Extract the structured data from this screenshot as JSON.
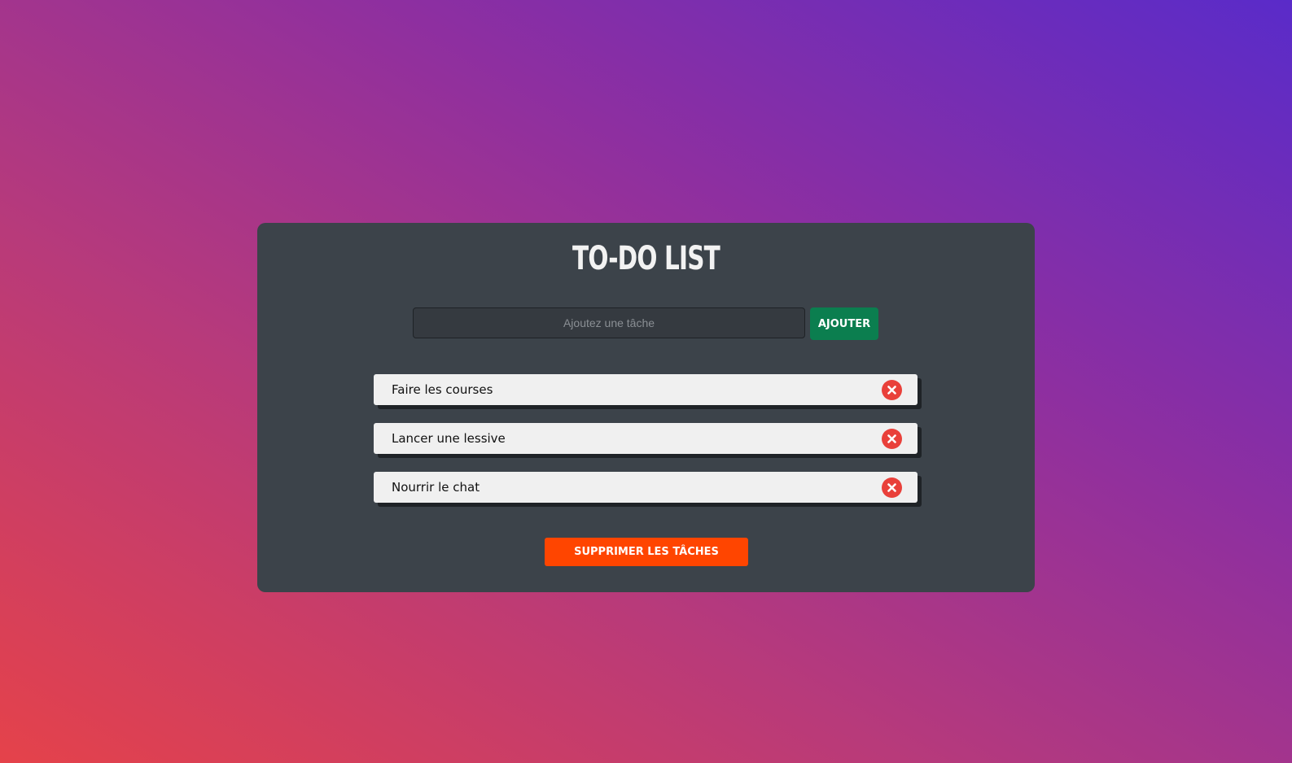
{
  "app": {
    "title": "TO-DO LIST"
  },
  "input": {
    "placeholder": "Ajoutez une tâche",
    "value": ""
  },
  "add_button": {
    "label": "AJOUTER"
  },
  "tasks": [
    {
      "label": "Faire les courses",
      "delete_icon": "close-icon"
    },
    {
      "label": "Lancer une lessive",
      "delete_icon": "close-icon"
    },
    {
      "label": "Nourrir le chat",
      "delete_icon": "close-icon"
    }
  ],
  "clear_button": {
    "label": "SUPPRIMER LES TÂCHES"
  },
  "colors": {
    "card": "#3c434a",
    "add_button": "#0b7e4f",
    "clear_button": "#ff4500",
    "delete": "#e9403a",
    "task_bg": "#f0f0f0"
  }
}
